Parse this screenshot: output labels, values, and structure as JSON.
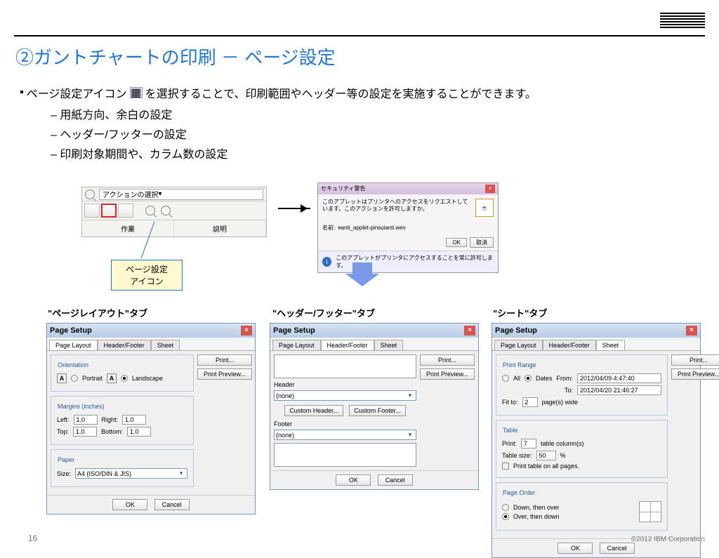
{
  "page": {
    "number": "16",
    "copyright": "©2012 IBM Corporation"
  },
  "title": "②ガントチャートの印刷 － ページ設定",
  "intro": {
    "prefix": "ページ設定アイコン",
    "suffix": "を選択することで、印刷範囲やヘッダー等の設定を実施することができます。"
  },
  "sublist": [
    "用紙方向、余白の設定",
    "ヘッダー/フッターの設定",
    "印刷対象期間や、カラム数の設定"
  ],
  "toolbar": {
    "dropdown": "アクションの選択",
    "col1": "作業",
    "col2": "説明"
  },
  "callout": {
    "line1": "ページ設定",
    "line2": "アイコン"
  },
  "security": {
    "title": "セキュリティ警告",
    "msg": "このアプレットはプリンタへのアクセスをリクエストしています。このアクションを許可しますか。",
    "name_label": "名前:",
    "name_value": "eanti_applet-pinsuianti.wev",
    "ok": "OK",
    "cancel": "取消",
    "footnote": "このアプレットがプリンタにアクセスすることを常に許可します。"
  },
  "labels": {
    "tab1": "\"ページレイアウト\"タブ",
    "tab2": "\"ヘッダー/フッター\"タブ",
    "tab3": "\"シート\"タブ"
  },
  "dlg_common": {
    "title": "Page Setup",
    "tabs": [
      "Page Layout",
      "Header/Footer",
      "Sheet"
    ],
    "print": "Print...",
    "preview": "Print Preview...",
    "ok": "OK",
    "cancel": "Cancel"
  },
  "dlg1": {
    "orientation": "Orientation",
    "portrait": "Portrait",
    "landscape": "Landscape",
    "margins": "Margins (inches)",
    "left_l": "Left:",
    "left_v": "1.0",
    "right_l": "Right:",
    "right_v": "1.0",
    "top_l": "Top:",
    "top_v": "1.0",
    "bottom_l": "Bottom:",
    "bottom_v": "1.0",
    "paper": "Paper",
    "size_l": "Size:",
    "size_v": "A4 (ISO/DIN & JIS)"
  },
  "dlg2": {
    "header": "Header",
    "none": "(none)",
    "custom_header": "Custom Header...",
    "custom_footer": "Custom Footer...",
    "footer": "Footer"
  },
  "dlg3": {
    "range": "Print Range",
    "all": "All",
    "dates": "Dates",
    "from": "From:",
    "from_v": "2012/04/09 4:47:40",
    "to": "To:",
    "to_v": "2012/04/20 21:46:27",
    "fit": "Fit to:",
    "fit_v": "2",
    "fit_suffix": "page(s) wide",
    "table": "Table",
    "print_l": "Print:",
    "print_v": "7",
    "print_suffix": "table column(s)",
    "size_l": "Table size:",
    "size_v": "50",
    "size_suffix": "%",
    "print_all": "Print table on all pages.",
    "order": "Page Order",
    "down_over": "Down, then over",
    "over_down": "Over, then down"
  }
}
